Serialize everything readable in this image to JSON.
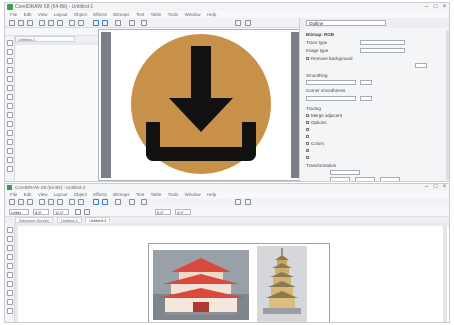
{
  "top_window": {
    "title": "CorelDRAW X8 (64-Bit) - Untitled-1",
    "menu": [
      "File",
      "Edit",
      "View",
      "Layout",
      "Object",
      "Effects",
      "Bitmaps",
      "Text",
      "Table",
      "Tools",
      "Window",
      "Help"
    ],
    "doc_tab": "Untitled-1",
    "dock": {
      "selector_value": "Outline",
      "section_title": "Bitmap: RGB",
      "rows": [
        "Trace type",
        "Image type",
        "Remove background",
        "Smoothing",
        "Corner smoothness",
        "Tracing",
        "Merge adjacent",
        "Options",
        "Colors",
        "Transformation"
      ]
    }
  },
  "bottom_window": {
    "title": "CorelDRAW X8 (64-Bit) - Untitled-2",
    "menu": [
      "File",
      "Edit",
      "View",
      "Layout",
      "Object",
      "Effects",
      "Bitmaps",
      "Text",
      "Table",
      "Tools",
      "Window",
      "Help"
    ],
    "propbar_fields": [
      "Letter",
      "8.5\"",
      "11.0\"",
      "0.0\"",
      "0.0\""
    ],
    "tabs": [
      "Welcome Screen",
      "Untitled-1",
      "Untitled-2"
    ]
  },
  "artwork": {
    "circle_color": "#c8914a",
    "arrow_color": "#111111",
    "background": "#7a7f88"
  },
  "icons": [
    "download-arrow-icon",
    "pagoda-image",
    "tower-image"
  ]
}
